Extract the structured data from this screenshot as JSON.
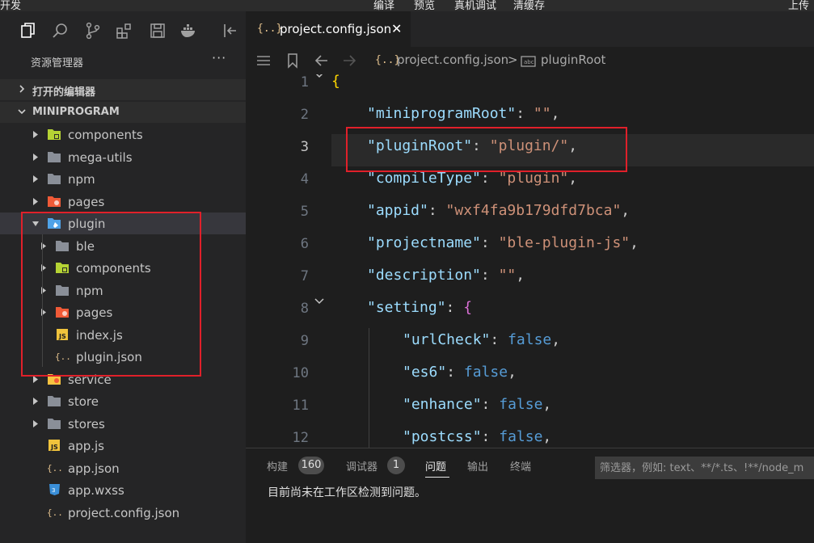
{
  "topbar": {
    "left_label": "开发",
    "actions": [
      "编译",
      "预览",
      "真机调试",
      "清缓存"
    ],
    "right_label": "上传"
  },
  "sidebar": {
    "title": "资源管理器",
    "more": "···",
    "icons": [
      "files-icon",
      "search-icon",
      "source-control-icon",
      "extensions-icon",
      "save-icon",
      "docker-icon",
      "collapse-icon"
    ],
    "sections": {
      "open_editors": "打开的编辑器",
      "project": "MINIPROGRAM"
    },
    "tree": [
      {
        "name": "components",
        "kind": "folder-green",
        "expanded": false,
        "depth": 1
      },
      {
        "name": "mega-utils",
        "kind": "folder",
        "expanded": false,
        "depth": 1
      },
      {
        "name": "npm",
        "kind": "folder",
        "expanded": false,
        "depth": 1
      },
      {
        "name": "pages",
        "kind": "folder-red",
        "expanded": false,
        "depth": 1
      },
      {
        "name": "plugin",
        "kind": "folder-blue",
        "expanded": true,
        "depth": 1
      },
      {
        "name": "ble",
        "kind": "folder",
        "expanded": false,
        "depth": 2
      },
      {
        "name": "components",
        "kind": "folder-green",
        "expanded": false,
        "depth": 2
      },
      {
        "name": "npm",
        "kind": "folder",
        "expanded": false,
        "depth": 2
      },
      {
        "name": "pages",
        "kind": "folder-red",
        "expanded": false,
        "depth": 2
      },
      {
        "name": "index.js",
        "kind": "js",
        "depth": 2
      },
      {
        "name": "plugin.json",
        "kind": "json",
        "depth": 2
      },
      {
        "name": "service",
        "kind": "folder-yellow",
        "expanded": false,
        "depth": 1
      },
      {
        "name": "store",
        "kind": "folder",
        "expanded": false,
        "depth": 1
      },
      {
        "name": "stores",
        "kind": "folder",
        "expanded": false,
        "depth": 1
      },
      {
        "name": "app.js",
        "kind": "js",
        "depth": 1
      },
      {
        "name": "app.json",
        "kind": "json",
        "depth": 1
      },
      {
        "name": "app.wxss",
        "kind": "css",
        "depth": 1
      },
      {
        "name": "project.config.json",
        "kind": "json",
        "depth": 1
      }
    ]
  },
  "editor": {
    "tab_icon": "{..}",
    "tab_label": "project.config.json",
    "tab_close": "✕",
    "breadcrumb": {
      "file_icon": "{..}",
      "file": "project.config.json",
      "separator": ">",
      "symbol": "pluginRoot"
    },
    "current_line": 3,
    "lines": [
      {
        "n": "1",
        "indent": 0,
        "tokens": [
          [
            "br1",
            "{"
          ]
        ]
      },
      {
        "n": "2",
        "indent": 1,
        "tokens": [
          [
            "k",
            "\"miniprogramRoot\""
          ],
          [
            "p",
            ": "
          ],
          [
            "s",
            "\"\""
          ],
          [
            "p",
            ","
          ]
        ]
      },
      {
        "n": "3",
        "indent": 1,
        "tokens": [
          [
            "k",
            "\"pluginRoot\""
          ],
          [
            "p",
            ": "
          ],
          [
            "s",
            "\"plugin/\""
          ],
          [
            "p",
            ","
          ]
        ]
      },
      {
        "n": "4",
        "indent": 1,
        "tokens": [
          [
            "k",
            "\"compileType\""
          ],
          [
            "p",
            ": "
          ],
          [
            "s",
            "\"plugin\""
          ],
          [
            "p",
            ","
          ]
        ]
      },
      {
        "n": "5",
        "indent": 1,
        "tokens": [
          [
            "k",
            "\"appid\""
          ],
          [
            "p",
            ": "
          ],
          [
            "s",
            "\"wxf4fa9b179dfd7bca\""
          ],
          [
            "p",
            ","
          ]
        ]
      },
      {
        "n": "6",
        "indent": 1,
        "tokens": [
          [
            "k",
            "\"projectname\""
          ],
          [
            "p",
            ": "
          ],
          [
            "s",
            "\"ble-plugin-js\""
          ],
          [
            "p",
            ","
          ]
        ]
      },
      {
        "n": "7",
        "indent": 1,
        "tokens": [
          [
            "k",
            "\"description\""
          ],
          [
            "p",
            ": "
          ],
          [
            "s",
            "\"\""
          ],
          [
            "p",
            ","
          ]
        ]
      },
      {
        "n": "8",
        "indent": 1,
        "tokens": [
          [
            "k",
            "\"setting\""
          ],
          [
            "p",
            ": "
          ],
          [
            "br2",
            "{"
          ]
        ]
      },
      {
        "n": "9",
        "indent": 2,
        "tokens": [
          [
            "k",
            "\"urlCheck\""
          ],
          [
            "p",
            ": "
          ],
          [
            "b",
            "false"
          ],
          [
            "p",
            ","
          ]
        ]
      },
      {
        "n": "10",
        "indent": 2,
        "tokens": [
          [
            "k",
            "\"es6\""
          ],
          [
            "p",
            ": "
          ],
          [
            "b",
            "false"
          ],
          [
            "p",
            ","
          ]
        ]
      },
      {
        "n": "11",
        "indent": 2,
        "tokens": [
          [
            "k",
            "\"enhance\""
          ],
          [
            "p",
            ": "
          ],
          [
            "b",
            "false"
          ],
          [
            "p",
            ","
          ]
        ]
      },
      {
        "n": "12",
        "indent": 2,
        "tokens": [
          [
            "k",
            "\"postcss\""
          ],
          [
            "p",
            ": "
          ],
          [
            "b",
            "false"
          ],
          [
            "p",
            ","
          ]
        ]
      }
    ]
  },
  "panel": {
    "tabs": [
      {
        "label": "构建",
        "badge": "160"
      },
      {
        "label": "调试器",
        "badge": "1"
      },
      {
        "label": "问题",
        "badge": null,
        "active": true
      },
      {
        "label": "输出",
        "badge": null
      },
      {
        "label": "终端",
        "badge": null
      }
    ],
    "filter_placeholder": "筛选器，例如: text、**/*.ts、!**/node_m",
    "message": "目前尚未在工作区检测到问题。"
  },
  "colors": {
    "highlight_box": "#e0202a",
    "string": "#ce9178",
    "key": "#9cdcfe",
    "keyword": "#569cd6"
  }
}
